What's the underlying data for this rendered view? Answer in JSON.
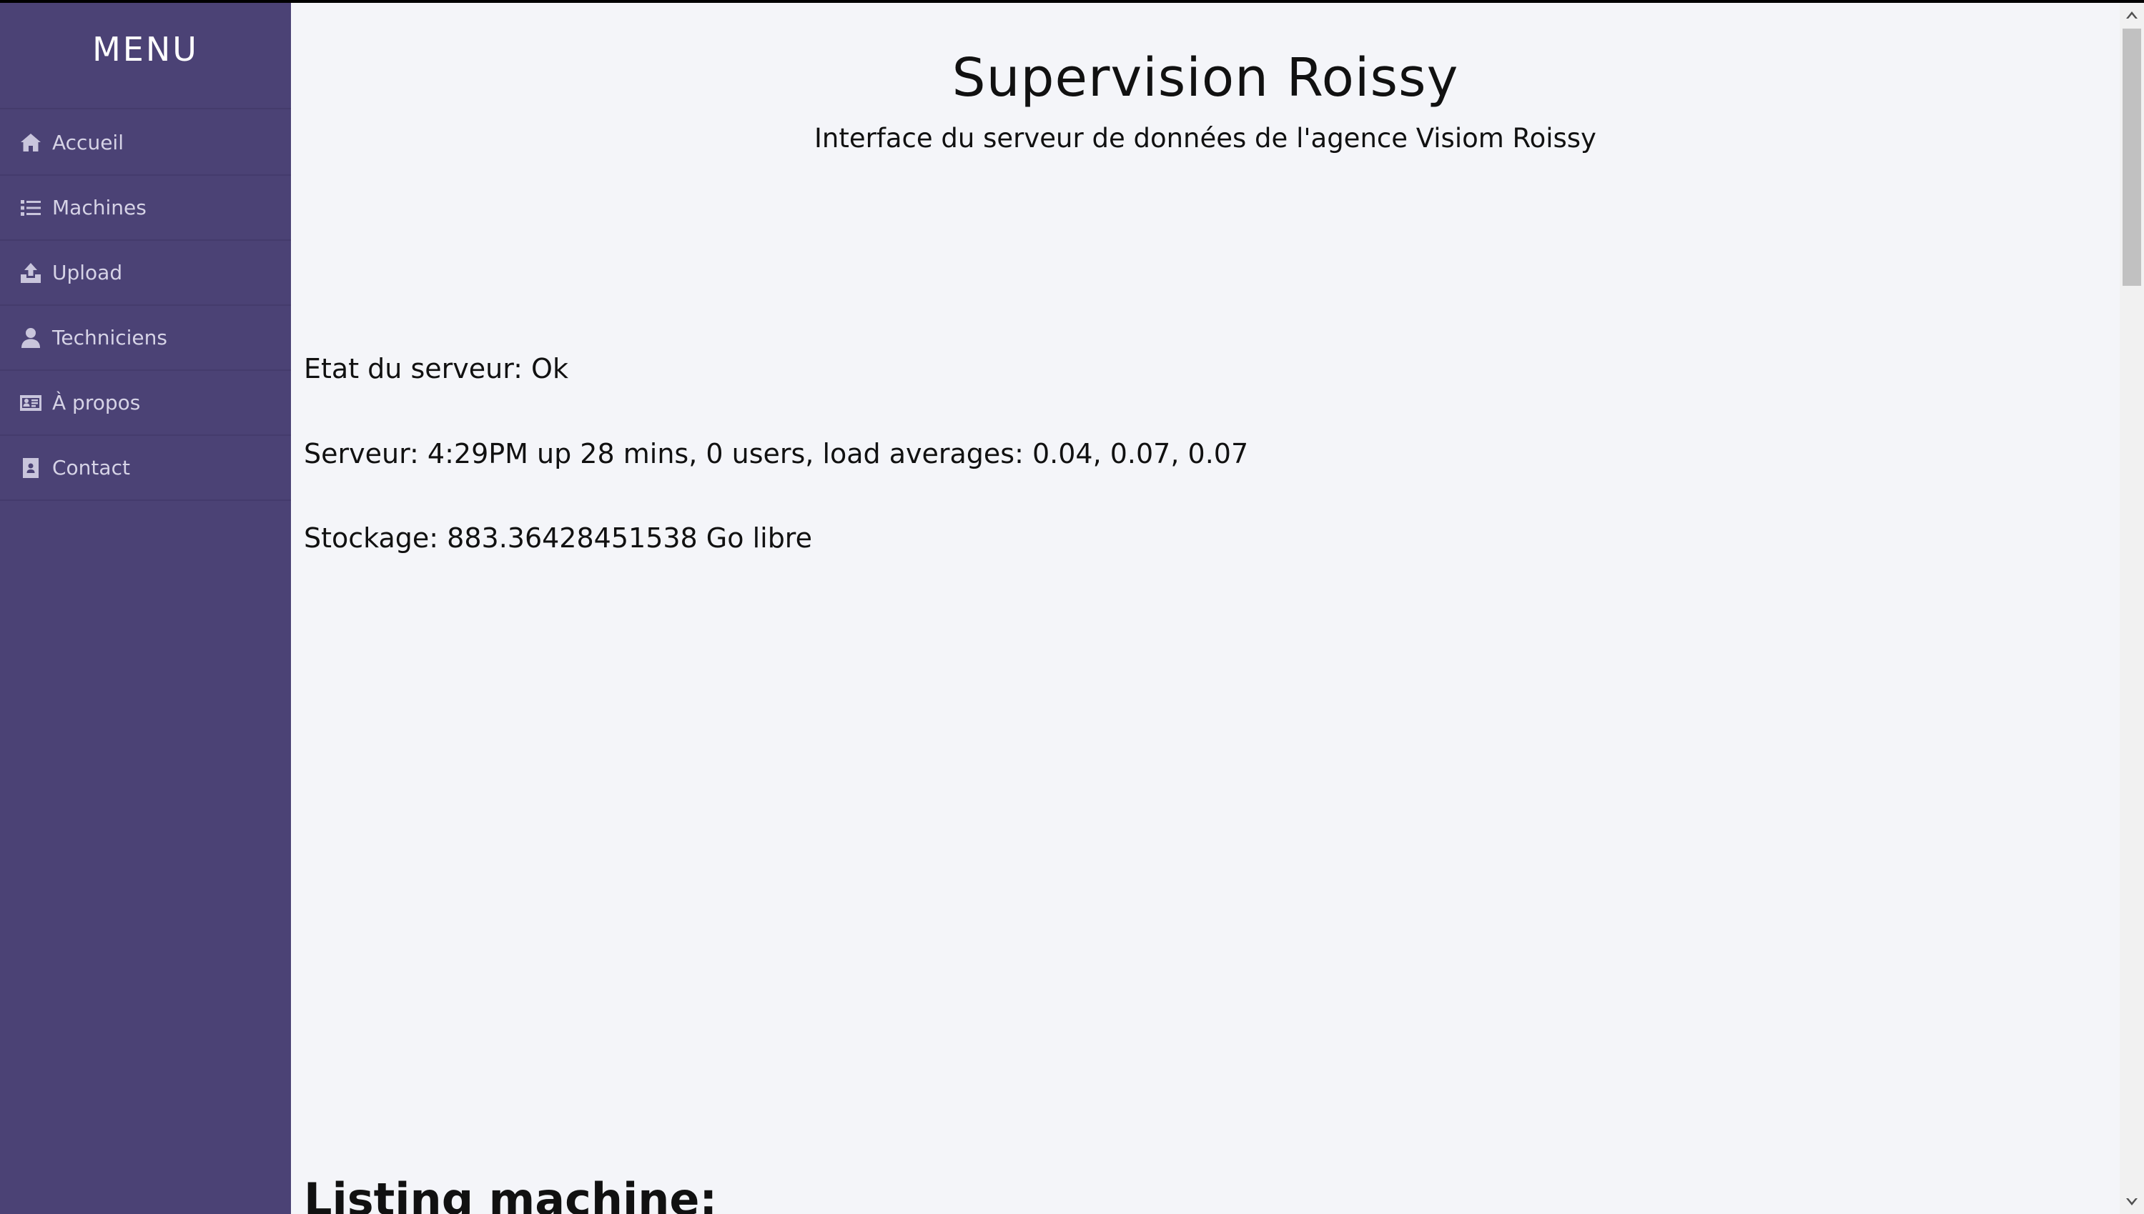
{
  "sidebar": {
    "title": "MENU",
    "items": [
      {
        "label": "Accueil",
        "icon": "home-icon"
      },
      {
        "label": "Machines",
        "icon": "list-icon"
      },
      {
        "label": "Upload",
        "icon": "upload-icon"
      },
      {
        "label": "Techniciens",
        "icon": "user-icon"
      },
      {
        "label": "À propos",
        "icon": "id-card-icon"
      },
      {
        "label": "Contact",
        "icon": "address-book-icon"
      }
    ]
  },
  "header": {
    "title": "Supervision Roissy",
    "subtitle": "Interface du serveur de données de l'agence Visiom Roissy"
  },
  "status": {
    "server_state": "Etat du serveur: Ok",
    "server_uptime": "Serveur: 4:29PM up 28 mins, 0 users, load averages: 0.04, 0.07, 0.07",
    "storage": "Stockage: 883.36428451538 Go libre"
  },
  "listing": {
    "heading": "Listing machine:"
  },
  "colors": {
    "sidebar_bg": "#4b4275",
    "page_bg": "#f4f5f9",
    "text": "#111111"
  }
}
